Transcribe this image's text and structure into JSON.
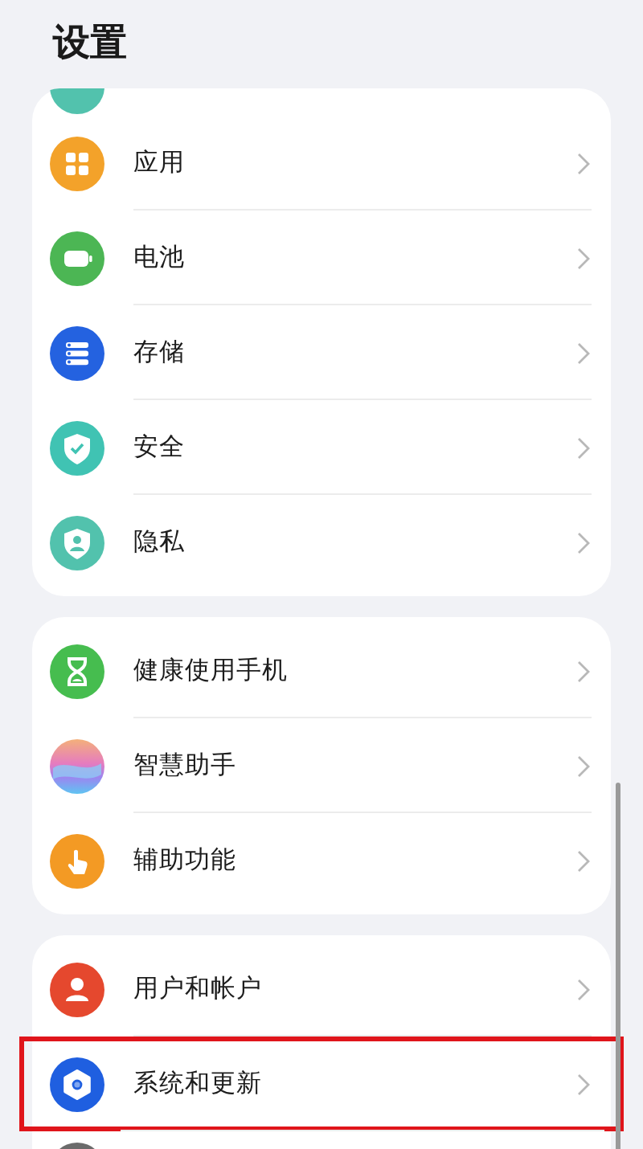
{
  "title": "设置",
  "groups": [
    {
      "items": [
        {
          "label": "应用",
          "kind": "apps",
          "highlighted": false
        },
        {
          "label": "电池",
          "kind": "battery",
          "highlighted": false
        },
        {
          "label": "存储",
          "kind": "storage",
          "highlighted": false
        },
        {
          "label": "安全",
          "kind": "security",
          "highlighted": false
        },
        {
          "label": "隐私",
          "kind": "privacy",
          "highlighted": false
        }
      ]
    },
    {
      "items": [
        {
          "label": "健康使用手机",
          "kind": "hourglass",
          "highlighted": false
        },
        {
          "label": "智慧助手",
          "kind": "assistant",
          "highlighted": false
        },
        {
          "label": "辅助功能",
          "kind": "accessibility",
          "highlighted": false
        }
      ]
    },
    {
      "items": [
        {
          "label": "用户和帐户",
          "kind": "user",
          "highlighted": false
        },
        {
          "label": "系统和更新",
          "kind": "system",
          "highlighted": true
        }
      ]
    }
  ]
}
